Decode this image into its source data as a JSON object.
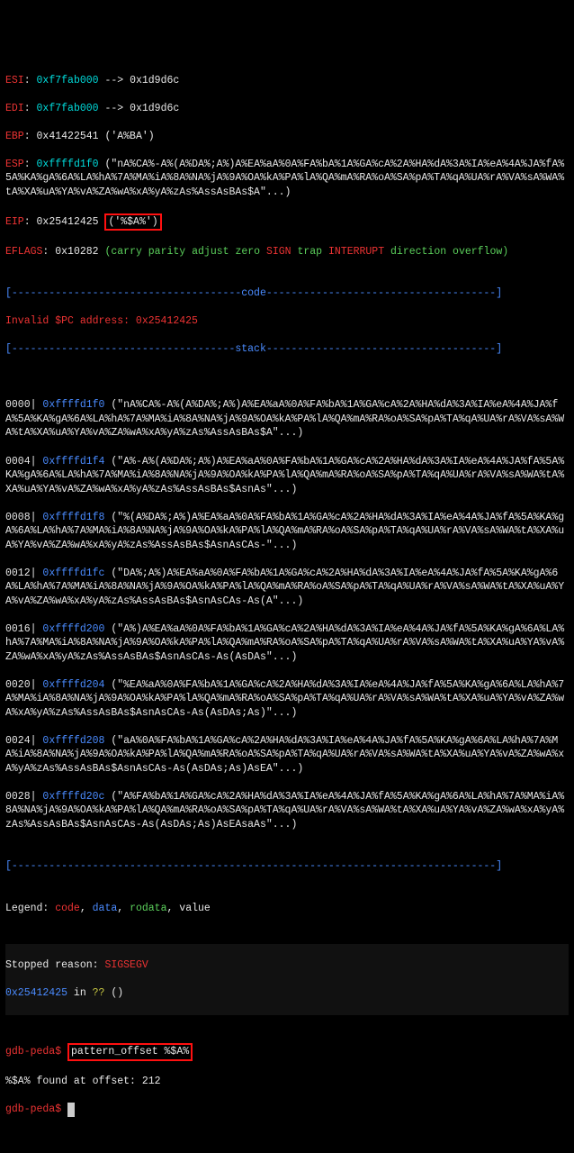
{
  "registers": {
    "esi": {
      "name": "ESI",
      "val": "0xf7fab000",
      "arrow": "-->",
      "deref": "0x1d9d6c"
    },
    "edi": {
      "name": "EDI",
      "val": "0xf7fab000",
      "arrow": "-->",
      "deref": "0x1d9d6c"
    },
    "ebp": {
      "name": "EBP",
      "val": "0x41422541",
      "note": "('A%BA')"
    },
    "esp": {
      "name": "ESP",
      "val": "0xffffd1f0",
      "note": "(\"nA%CA%-A%(A%DA%;A%)A%EA%aA%0A%FA%bA%1A%GA%cA%2A%HA%dA%3A%IA%eA%4A%JA%fA%5A%KA%gA%6A%LA%hA%7A%MA%iA%8A%NA%jA%9A%OA%kA%PA%lA%QA%mA%RA%oA%SA%pA%TA%qA%UA%rA%VA%sA%WA%tA%XA%uA%YA%vA%ZA%wA%xA%yA%zAs%AssAsBAs$A\"...)"
    },
    "eip": {
      "name": "EIP",
      "val": "0x25412425",
      "note": "('%$A%')"
    },
    "eflags": {
      "name": "EFLAGS",
      "val": "0x10282"
    }
  },
  "eflags_parts": {
    "open": "(",
    "carry": "carry",
    "parity": "parity",
    "adjust": "adjust",
    "zero": "zero",
    "sign": "SIGN",
    "trap": "trap",
    "interrupt": "INTERRUPT",
    "direction": "direction",
    "overflow": "overflow",
    "close": ")"
  },
  "sections": {
    "code_rule": "[-------------------------------------code-------------------------------------]",
    "invalid_pc": "Invalid $PC address: 0x25412425",
    "stack_rule": "[------------------------------------stack-------------------------------------]",
    "end_rule": "[------------------------------------------------------------------------------]"
  },
  "stack": [
    {
      "idx": "0000|",
      "addr": "0xffffd1f0",
      "val": "(\"nA%CA%-A%(A%DA%;A%)A%EA%aA%0A%FA%bA%1A%GA%cA%2A%HA%dA%3A%IA%eA%4A%JA%fA%5A%KA%gA%6A%LA%hA%7A%MA%iA%8A%NA%jA%9A%OA%kA%PA%lA%QA%mA%RA%oA%SA%pA%TA%qA%UA%rA%VA%sA%WA%tA%XA%uA%YA%vA%ZA%wA%xA%yA%zAs%AssAsBAs$A\"...)"
    },
    {
      "idx": "0004|",
      "addr": "0xffffd1f4",
      "val": "(\"A%-A%(A%DA%;A%)A%EA%aA%0A%FA%bA%1A%GA%cA%2A%HA%dA%3A%IA%eA%4A%JA%fA%5A%KA%gA%6A%LA%hA%7A%MA%iA%8A%NA%jA%9A%OA%kA%PA%lA%QA%mA%RA%oA%SA%pA%TA%qA%UA%rA%VA%sA%WA%tA%XA%uA%YA%vA%ZA%wA%xA%yA%zAs%AssAsBAs$AsnAs\"...)"
    },
    {
      "idx": "0008|",
      "addr": "0xffffd1f8",
      "val": "(\"%(A%DA%;A%)A%EA%aA%0A%FA%bA%1A%GA%cA%2A%HA%dA%3A%IA%eA%4A%JA%fA%5A%KA%gA%6A%LA%hA%7A%MA%iA%8A%NA%jA%9A%OA%kA%PA%lA%QA%mA%RA%oA%SA%pA%TA%qA%UA%rA%VA%sA%WA%tA%XA%uA%YA%vA%ZA%wA%xA%yA%zAs%AssAsBAs$AsnAsCAs-\"...)"
    },
    {
      "idx": "0012|",
      "addr": "0xffffd1fc",
      "val": "(\"DA%;A%)A%EA%aA%0A%FA%bA%1A%GA%cA%2A%HA%dA%3A%IA%eA%4A%JA%fA%5A%KA%gA%6A%LA%hA%7A%MA%iA%8A%NA%jA%9A%OA%kA%PA%lA%QA%mA%RA%oA%SA%pA%TA%qA%UA%rA%VA%sA%WA%tA%XA%uA%YA%vA%ZA%wA%xA%yA%zAs%AssAsBAs$AsnAsCAs-As(A\"...)"
    },
    {
      "idx": "0016|",
      "addr": "0xffffd200",
      "val": "(\"A%)A%EA%aA%0A%FA%bA%1A%GA%cA%2A%HA%dA%3A%IA%eA%4A%JA%fA%5A%KA%gA%6A%LA%hA%7A%MA%iA%8A%NA%jA%9A%OA%kA%PA%lA%QA%mA%RA%oA%SA%pA%TA%qA%UA%rA%VA%sA%WA%tA%XA%uA%YA%vA%ZA%wA%xA%yA%zAs%AssAsBAs$AsnAsCAs-As(AsDAs\"...)"
    },
    {
      "idx": "0020|",
      "addr": "0xffffd204",
      "val": "(\"%EA%aA%0A%FA%bA%1A%GA%cA%2A%HA%dA%3A%IA%eA%4A%JA%fA%5A%KA%gA%6A%LA%hA%7A%MA%iA%8A%NA%jA%9A%OA%kA%PA%lA%QA%mA%RA%oA%SA%pA%TA%qA%UA%rA%VA%sA%WA%tA%XA%uA%YA%vA%ZA%wA%xA%yA%zAs%AssAsBAs$AsnAsCAs-As(AsDAs;As)\"...)"
    },
    {
      "idx": "0024|",
      "addr": "0xffffd208",
      "val": "(\"aA%0A%FA%bA%1A%GA%cA%2A%HA%dA%3A%IA%eA%4A%JA%fA%5A%KA%gA%6A%LA%hA%7A%MA%iA%8A%NA%jA%9A%OA%kA%PA%lA%QA%mA%RA%oA%SA%pA%TA%qA%UA%rA%VA%sA%WA%tA%XA%uA%YA%vA%ZA%wA%xA%yA%zAs%AssAsBAs$AsnAsCAs-As(AsDAs;As)AsEA\"...)"
    },
    {
      "idx": "0028|",
      "addr": "0xffffd20c",
      "val": "(\"A%FA%bA%1A%GA%cA%2A%HA%dA%3A%IA%eA%4A%JA%fA%5A%KA%gA%6A%LA%hA%7A%MA%iA%8A%NA%jA%9A%OA%kA%PA%lA%QA%mA%RA%oA%SA%pA%TA%qA%UA%rA%VA%sA%WA%tA%XA%uA%YA%vA%ZA%wA%xA%yA%zAs%AssAsBAs$AsnAsCAs-As(AsDAs;As)AsEAsaAs\"...)"
    }
  ],
  "legend": {
    "label": "Legend:",
    "code": "code",
    "data": "data",
    "rodata": "rodata",
    "value": "value"
  },
  "stopped": {
    "label": "Stopped reason:",
    "reason": "SIGSEGV",
    "addr": "0x25412425",
    "in": "in",
    "func": "??",
    "tail": "()"
  },
  "prompt1": {
    "prompt": "gdb-peda$ ",
    "cmd": "pattern_offset %$A%"
  },
  "result": "%$A% found at offset: 212",
  "prompt2": {
    "prompt": "gdb-peda$ "
  }
}
